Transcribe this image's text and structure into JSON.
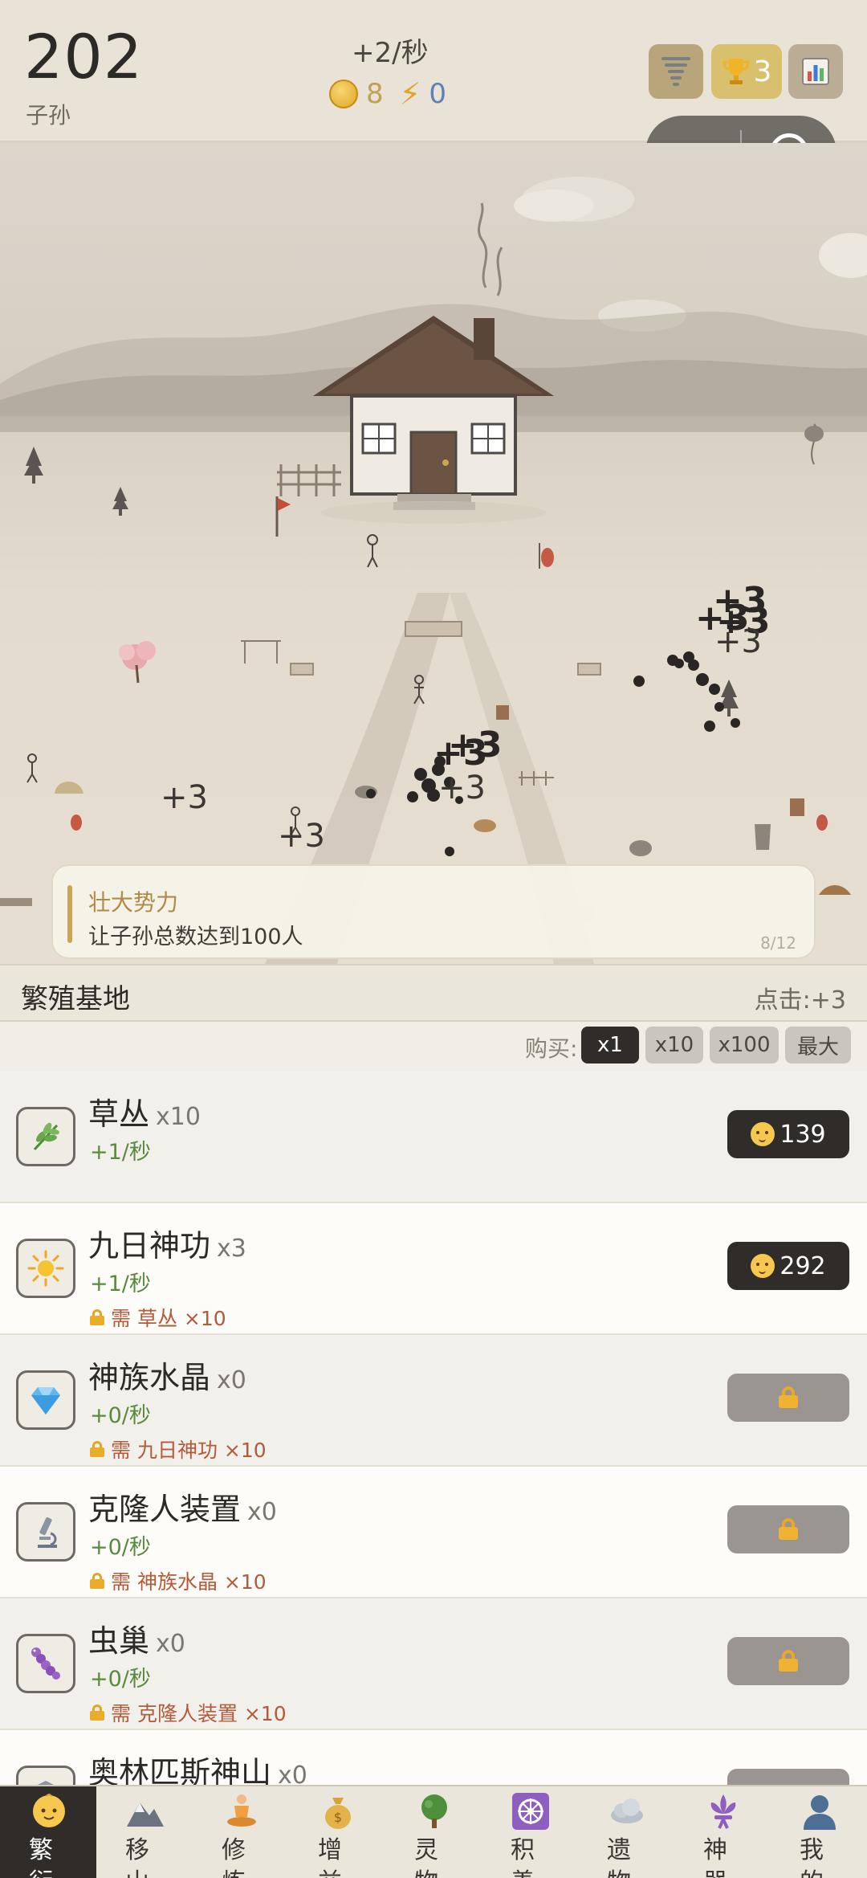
{
  "header": {
    "score": "202",
    "score_label": "子孙",
    "rate": "+2/秒",
    "coins": "8",
    "energy": "0",
    "trophy_count": "3"
  },
  "scene": {
    "floating_numbers": [
      "+3",
      "+3",
      "+3",
      "+3",
      "+3",
      "+3",
      "+3",
      "+3",
      "+3"
    ]
  },
  "quest": {
    "title": "壮大势力",
    "description": "让子孙总数达到100人",
    "progress": "8/12"
  },
  "section": {
    "title": "繁殖基地",
    "click_value": "点击:+3"
  },
  "buy": {
    "label": "购买:",
    "options": [
      "x1",
      "x10",
      "x100",
      "最大"
    ],
    "selected": "x1"
  },
  "items": [
    {
      "name": "草丛",
      "count": "x10",
      "rate": "+1/秒",
      "requirement": "",
      "price": "139",
      "locked": false,
      "icon": "herb-icon"
    },
    {
      "name": "九日神功",
      "count": "x3",
      "rate": "+1/秒",
      "requirement": "需 草丛 ×10",
      "price": "292",
      "locked": false,
      "icon": "sun-icon"
    },
    {
      "name": "神族水晶",
      "count": "x0",
      "rate": "+0/秒",
      "requirement": "需 九日神功 ×10",
      "price": "",
      "locked": true,
      "icon": "gem-icon"
    },
    {
      "name": "克隆人装置",
      "count": "x0",
      "rate": "+0/秒",
      "requirement": "需 神族水晶 ×10",
      "price": "",
      "locked": true,
      "icon": "microscope-icon"
    },
    {
      "name": "虫巢",
      "count": "x0",
      "rate": "+0/秒",
      "requirement": "需 克隆人装置 ×10",
      "price": "",
      "locked": true,
      "icon": "worm-icon"
    },
    {
      "name": "奥林匹斯神山",
      "count": "x0",
      "rate": "",
      "requirement": "",
      "price": "",
      "locked": true,
      "icon": "temple-icon"
    }
  ],
  "nav": [
    {
      "label": "繁衍",
      "icon": "baby-icon",
      "active": true
    },
    {
      "label": "移山",
      "icon": "mountain-icon",
      "active": false
    },
    {
      "label": "修炼",
      "icon": "meditate-icon",
      "active": false
    },
    {
      "label": "增益",
      "icon": "money-bag-icon",
      "active": false
    },
    {
      "label": "灵物",
      "icon": "tree-icon",
      "active": false
    },
    {
      "label": "积善",
      "icon": "dharma-wheel-icon",
      "active": false
    },
    {
      "label": "遗物",
      "icon": "cloud-icon",
      "active": false
    },
    {
      "label": "神器",
      "icon": "fleur-de-lis-icon",
      "active": false
    },
    {
      "label": "我的",
      "icon": "user-icon",
      "active": false
    }
  ],
  "colors": {
    "accent_dark": "#2f2c29",
    "gold": "#c9a657",
    "rate_green": "#5a8a3e",
    "requirement_red": "#b45a3a"
  }
}
